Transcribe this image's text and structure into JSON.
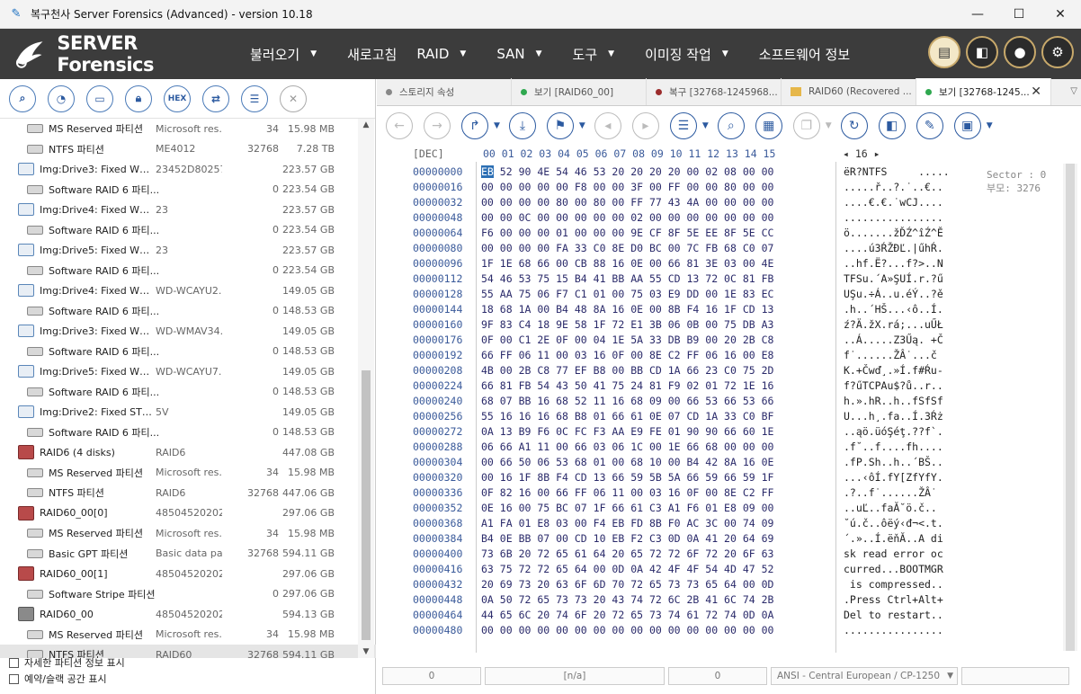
{
  "window": {
    "title": "복구천사 Server Forensics (Advanced) - version 10.18",
    "minimize": "—",
    "maximize": "☐",
    "close": "✕"
  },
  "menubar": {
    "logo_text": "SERVER Forensics",
    "items": [
      {
        "label": "불러오기",
        "has_caret": true
      },
      {
        "label": "새로고침",
        "has_caret": false
      },
      {
        "label": "RAID",
        "has_caret": true
      },
      {
        "label": "SAN",
        "has_caret": true
      },
      {
        "label": "도구",
        "has_caret": true
      },
      {
        "label": "이미징 작업",
        "has_caret": true
      },
      {
        "label": "소프트웨어 정보",
        "has_caret": false
      }
    ],
    "right_icons": [
      "report-icon",
      "layout-icon",
      "user-icon",
      "settings-icon"
    ]
  },
  "left_toolbar": {
    "icons": [
      "search-icon",
      "disk-scan-icon",
      "folder-open-icon",
      "lock-icon",
      "hex-icon",
      "transfer-icon",
      "list-icon",
      "close-icon"
    ],
    "hex_label": "HEX"
  },
  "tree": {
    "rows": [
      {
        "name": "MS Reserved 파티션",
        "desc": "Microsoft res...",
        "num": "34",
        "size": "15.98 MB",
        "indent": 1,
        "type": "part"
      },
      {
        "name": "NTFS 파티션",
        "desc": "ME4012",
        "num": "32768",
        "size": "7.28 TB",
        "indent": 1,
        "type": "part"
      },
      {
        "name": "Img:Drive3: Fixed WD ...",
        "desc": "23452D802577",
        "num": "",
        "size": "223.57 GB",
        "indent": 0,
        "type": "disk"
      },
      {
        "name": "Software RAID 6 파티...",
        "desc": "",
        "num": "0",
        "size": "223.54 GB",
        "indent": 1,
        "type": "part"
      },
      {
        "name": "Img:Drive4: Fixed WD ...",
        "desc": "23",
        "num": "",
        "size": "223.57 GB",
        "indent": 0,
        "type": "disk"
      },
      {
        "name": "Software RAID 6 파티...",
        "desc": "",
        "num": "0",
        "size": "223.54 GB",
        "indent": 1,
        "type": "part"
      },
      {
        "name": "Img:Drive5: Fixed WD ...",
        "desc": "23",
        "num": "",
        "size": "223.57 GB",
        "indent": 0,
        "type": "disk"
      },
      {
        "name": "Software RAID 6 파티...",
        "desc": "",
        "num": "0",
        "size": "223.54 GB",
        "indent": 1,
        "type": "part"
      },
      {
        "name": "Img:Drive4: Fixed WD...",
        "desc": "WD-WCAYU2...",
        "num": "",
        "size": "149.05 GB",
        "indent": 0,
        "type": "disk"
      },
      {
        "name": "Software RAID 6 파티...",
        "desc": "",
        "num": "0",
        "size": "148.53 GB",
        "indent": 1,
        "type": "part"
      },
      {
        "name": "Img:Drive3: Fixed WD...",
        "desc": "WD-WMAV34...",
        "num": "",
        "size": "149.05 GB",
        "indent": 0,
        "type": "disk"
      },
      {
        "name": "Software RAID 6 파티...",
        "desc": "",
        "num": "0",
        "size": "148.53 GB",
        "indent": 1,
        "type": "part"
      },
      {
        "name": "Img:Drive5: Fixed WD...",
        "desc": "WD-WCAYU7...",
        "num": "",
        "size": "149.05 GB",
        "indent": 0,
        "type": "disk"
      },
      {
        "name": "Software RAID 6 파티...",
        "desc": "",
        "num": "0",
        "size": "148.53 GB",
        "indent": 1,
        "type": "part"
      },
      {
        "name": "Img:Drive2: Fixed ST3...",
        "desc": "5V",
        "num": "",
        "size": "149.05 GB",
        "indent": 0,
        "type": "disk"
      },
      {
        "name": "Software RAID 6 파티...",
        "desc": "",
        "num": "0",
        "size": "148.53 GB",
        "indent": 1,
        "type": "part"
      },
      {
        "name": "RAID6 (4 disks)",
        "desc": "RAID6",
        "num": "",
        "size": "447.08 GB",
        "indent": 0,
        "type": "raid"
      },
      {
        "name": "MS Reserved 파티션",
        "desc": "Microsoft res...",
        "num": "34",
        "size": "15.98 MB",
        "indent": 1,
        "type": "part"
      },
      {
        "name": "NTFS 파티션",
        "desc": "RAID6",
        "num": "32768",
        "size": "447.06 GB",
        "indent": 1,
        "type": "part"
      },
      {
        "name": "RAID60_00[0]",
        "desc": "48504520202...",
        "num": "",
        "size": "297.06 GB",
        "indent": 0,
        "type": "raid"
      },
      {
        "name": "MS Reserved 파티션",
        "desc": "Microsoft res...",
        "num": "34",
        "size": "15.98 MB",
        "indent": 1,
        "type": "part"
      },
      {
        "name": "Basic GPT 파티션",
        "desc": "Basic data pa...",
        "num": "32768",
        "size": "594.11 GB",
        "indent": 1,
        "type": "part"
      },
      {
        "name": "RAID60_00[1]",
        "desc": "48504520202...",
        "num": "",
        "size": "297.06 GB",
        "indent": 0,
        "type": "raid"
      },
      {
        "name": "Software Stripe 파티션",
        "desc": "",
        "num": "0",
        "size": "297.06 GB",
        "indent": 1,
        "type": "part"
      },
      {
        "name": "RAID60_00",
        "desc": "48504520202...",
        "num": "",
        "size": "594.13 GB",
        "indent": 0,
        "type": "raidgray"
      },
      {
        "name": "MS Reserved 파티션",
        "desc": "Microsoft res...",
        "num": "34",
        "size": "15.98 MB",
        "indent": 1,
        "type": "part"
      },
      {
        "name": "NTFS 파티션",
        "desc": "RAID60",
        "num": "32768",
        "size": "594.11 GB",
        "indent": 1,
        "type": "part",
        "selected": true
      }
    ]
  },
  "options": {
    "show_partition_info": "자세한 파티션 정보 표시",
    "show_reserved_space": "예약/슬랙 공간 표시"
  },
  "tabs": [
    {
      "label": "스토리지 속성",
      "dot": "#888888",
      "active": false
    },
    {
      "label": "보기 [RAID60_00]",
      "dot": "#2fa84f",
      "active": false
    },
    {
      "label": "복구 [32768-1245968...",
      "dot": "#9b2c2c",
      "active": false
    },
    {
      "label": "RAID60 (Recovered ...",
      "dot": "folder",
      "active": false
    },
    {
      "label": "보기 [32768-1245...",
      "dot": "#2fa84f",
      "active": true
    }
  ],
  "tab_close": "✕",
  "hex_toolbar": {
    "icons": [
      "back-icon",
      "forward-icon",
      "goto-icon",
      "download-icon",
      "bookmark-icon",
      "prev-bookmark-icon",
      "next-bookmark-icon",
      "list-view-icon",
      "search-icon",
      "grid-icon",
      "copy-icon",
      "refresh-icon",
      "panel-icon",
      "edit-icon",
      "save-icon"
    ]
  },
  "hex_header": {
    "mode": "[DEC]",
    "columns": "00 01 02 03 04 05 06 07 08 09 10 11 12 13 14 15",
    "page": "◂ 16 ▸"
  },
  "sector_info": {
    "sector": "Sector : 0",
    "parent": "부모: 3276"
  },
  "hex_rows": [
    {
      "off": "00000000",
      "first": "EB",
      "bytes": "52 90 4E 54 46 53 20 20 20 20 00 02 08 00 00",
      "ascii": "ëR?NTFS     ....."
    },
    {
      "off": "00000016",
      "first": "00",
      "bytes": "00 00 00 00 F8 00 00 3F 00 FF 00 00 80 00 00",
      "ascii": ".....ř..?.˙..€.."
    },
    {
      "off": "00000032",
      "first": "00",
      "bytes": "00 00 00 80 00 80 00 FF 77 43 4A 00 00 00 00",
      "ascii": "....€.€.˙wCJ...."
    },
    {
      "off": "00000048",
      "first": "00",
      "bytes": "00 0C 00 00 00 00 00 02 00 00 00 00 00 00 00",
      "ascii": "................"
    },
    {
      "off": "00000064",
      "first": "F6",
      "bytes": "00 00 00 01 00 00 00 9E CF 8F 5E EE 8F 5E CC",
      "ascii": "ö.......žĎŹ^îŹ^Ě"
    },
    {
      "off": "00000080",
      "first": "00",
      "bytes": "00 00 00 FA 33 C0 8E D0 BC 00 7C FB 68 C0 07",
      "ascii": "....ú3ŔŽĐĽ.|űhŔ."
    },
    {
      "off": "00000096",
      "first": "1F",
      "bytes": "1E 68 66 00 CB 88 16 0E 00 66 81 3E 03 00 4E",
      "ascii": "..hf.Ë?...f?>..N"
    },
    {
      "off": "00000112",
      "first": "54",
      "bytes": "46 53 75 15 B4 41 BB AA 55 CD 13 72 0C 81 FB",
      "ascii": "TFSu.´A»ŞUÍ.r.?ű"
    },
    {
      "off": "00000128",
      "first": "55",
      "bytes": "AA 75 06 F7 C1 01 00 75 03 E9 DD 00 1E 83 EC",
      "ascii": "UŞu.÷Á..u.éÝ..?ě"
    },
    {
      "off": "00000144",
      "first": "18",
      "bytes": "68 1A 00 B4 48 8A 16 0E 00 8B F4 16 1F CD 13",
      "ascii": ".h..´HŠ...‹ô..Í."
    },
    {
      "off": "00000160",
      "first": "9F",
      "bytes": "83 C4 18 9E 58 1F 72 E1 3B 06 0B 00 75 DB A3",
      "ascii": "ź?Ä.žX.rá;...uŰŁ"
    },
    {
      "off": "00000176",
      "first": "0F",
      "bytes": "00 C1 2E 0F 00 04 1E 5A 33 DB B9 00 20 2B C8",
      "ascii": "..Á.....Z3Űą. +Č"
    },
    {
      "off": "00000192",
      "first": "66",
      "bytes": "FF 06 11 00 03 16 0F 00 8E C2 FF 06 16 00 E8",
      "ascii": "f˙......ŽÂ˙...č"
    },
    {
      "off": "00000208",
      "first": "4B",
      "bytes": "00 2B C8 77 EF B8 00 BB CD 1A 66 23 C0 75 2D",
      "ascii": "K.+Čwď¸.»Í.f#Ŕu-"
    },
    {
      "off": "00000224",
      "first": "66",
      "bytes": "81 FB 54 43 50 41 75 24 81 F9 02 01 72 1E 16",
      "ascii": "f?űTCPAu$?ů..r.."
    },
    {
      "off": "00000240",
      "first": "68",
      "bytes": "07 BB 16 68 52 11 16 68 09 00 66 53 66 53 66",
      "ascii": "h.».hR..h..fSfSf"
    },
    {
      "off": "00000256",
      "first": "55",
      "bytes": "16 16 16 68 B8 01 66 61 0E 07 CD 1A 33 C0 BF",
      "ascii": "U...h¸.fa..Í.3Ŕż"
    },
    {
      "off": "00000272",
      "first": "0A",
      "bytes": "13 B9 F6 0C FC F3 AA E9 FE 01 90 90 66 60 1E",
      "ascii": "..ąö.üóŞéţ.??f`."
    },
    {
      "off": "00000288",
      "first": "06",
      "bytes": "66 A1 11 00 66 03 06 1C 00 1E 66 68 00 00 00",
      "ascii": ".f˘..f....fh...."
    },
    {
      "off": "00000304",
      "first": "00",
      "bytes": "66 50 06 53 68 01 00 68 10 00 B4 42 8A 16 0E",
      "ascii": ".fP.Sh..h..´BŠ.."
    },
    {
      "off": "00000320",
      "first": "00",
      "bytes": "16 1F 8B F4 CD 13 66 59 5B 5A 66 59 66 59 1F",
      "ascii": "...‹ôÍ.fY[ZfYfY."
    },
    {
      "off": "00000336",
      "first": "0F",
      "bytes": "82 16 00 66 FF 06 11 00 03 16 0F 00 8E C2 FF",
      "ascii": ".?..f˙......ŽÂ˙"
    },
    {
      "off": "00000352",
      "first": "0E",
      "bytes": "16 00 75 BC 07 1F 66 61 C3 A1 F6 01 E8 09 00",
      "ascii": "..uĽ..faĂ˘ö.č.."
    },
    {
      "off": "00000368",
      "first": "A1",
      "bytes": "FA 01 E8 03 00 F4 EB FD 8B F0 AC 3C 00 74 09",
      "ascii": "˘ú.č..ôëý‹đ¬<.t."
    },
    {
      "off": "00000384",
      "first": "B4",
      "bytes": "0E BB 07 00 CD 10 EB F2 C3 0D 0A 41 20 64 69",
      "ascii": "´.»..Í.ëňĂ..A di"
    },
    {
      "off": "00000400",
      "first": "73",
      "bytes": "6B 20 72 65 61 64 20 65 72 72 6F 72 20 6F 63",
      "ascii": "sk read error oc"
    },
    {
      "off": "00000416",
      "first": "63",
      "bytes": "75 72 72 65 64 00 0D 0A 42 4F 4F 54 4D 47 52",
      "ascii": "curred...BOOTMGR"
    },
    {
      "off": "00000432",
      "first": "20",
      "bytes": "69 73 20 63 6F 6D 70 72 65 73 73 65 64 00 0D",
      "ascii": " is compressed.."
    },
    {
      "off": "00000448",
      "first": "0A",
      "bytes": "50 72 65 73 73 20 43 74 72 6C 2B 41 6C 74 2B",
      "ascii": ".Press Ctrl+Alt+"
    },
    {
      "off": "00000464",
      "first": "44",
      "bytes": "65 6C 20 74 6F 20 72 65 73 74 61 72 74 0D 0A",
      "ascii": "Del to restart.."
    },
    {
      "off": "00000480",
      "first": "00",
      "bytes": "00 00 00 00 00 00 00 00 00 00 00 00 00 00 00",
      "ascii": "................"
    }
  ],
  "status": {
    "f1": "0",
    "f2": "[n/a]",
    "f3": "0",
    "encoding": "ANSI - Central European / CP-1250",
    "encoding_caret": "▼"
  },
  "colors": {
    "menubar_bg": "#3c3c3c",
    "accent": "#2c5aa0",
    "selection": "#2c6fb4"
  }
}
